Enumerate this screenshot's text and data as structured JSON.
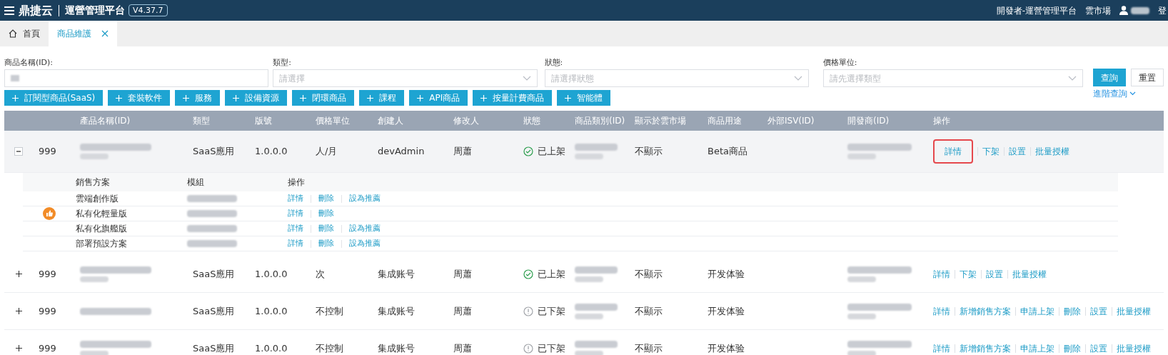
{
  "top_bar": {
    "logo": "鼎捷云",
    "title": "運營管理平台",
    "version": "V4.37.7",
    "links": [
      "開發者-運營管理平台",
      "雲市場"
    ],
    "logout": "登"
  },
  "tabs": [
    {
      "label": "首頁",
      "selected": false,
      "closable": false
    },
    {
      "label": "商品維護",
      "selected": true,
      "closable": true
    }
  ],
  "filters": [
    {
      "label": "商品名稱(ID):",
      "has_value": true,
      "kind": "text"
    },
    {
      "label": "類型:",
      "placeholder": "請選擇",
      "has_value": false,
      "kind": "select"
    },
    {
      "label": "狀態:",
      "placeholder": "請選擇狀態",
      "has_value": false,
      "kind": "select"
    },
    {
      "label": "價格單位:",
      "placeholder": "請先選擇類型",
      "has_value": false,
      "kind": "select"
    }
  ],
  "search_button": "查詢",
  "reset_button": "重置",
  "advanced_link": "進階查詢",
  "add_buttons": [
    "訂閱型商品(SaaS)",
    "套裝軟件",
    "服務",
    "設備資源",
    "閉環商品",
    "課程",
    "API商品",
    "按量計費商品",
    "智能體"
  ],
  "table": {
    "columns": [
      "產品名稱(ID)",
      "類型",
      "版號",
      "價格單位",
      "創建人",
      "修改人",
      "狀態",
      "商品類別(ID)",
      "顯示於雲市場",
      "商品用途",
      "外部ISV(ID)",
      "開發商(ID)",
      "操作"
    ],
    "rows": [
      {
        "expanded": true,
        "id": "999",
        "type": "SaaS應用",
        "version": "1.0.0.0",
        "price_unit": "人/月",
        "creator": "devAdmin",
        "modifier": "周蕭",
        "status": {
          "kind": "on",
          "label": "已上架"
        },
        "display": "不顯示",
        "usage": "Beta商品",
        "operations": [
          {
            "label": "詳情",
            "highlighted": true
          },
          {
            "label": "下架",
            "highlighted": false
          },
          {
            "label": "設置",
            "highlighted": false
          },
          {
            "label": "批量授權",
            "highlighted": false
          }
        ],
        "plans": {
          "columns": [
            "銷售方案",
            "模組",
            "操作"
          ],
          "rows": [
            {
              "name": "雲端創作版",
              "recommended": false,
              "operations": [
                "詳情",
                "刪除",
                "設為推薦"
              ]
            },
            {
              "name": "私有化輕量版",
              "recommended": true,
              "operations": [
                "詳情",
                "刪除"
              ]
            },
            {
              "name": "私有化旗艦版",
              "recommended": false,
              "operations": [
                "詳情",
                "刪除",
                "設為推薦"
              ]
            },
            {
              "name": "部署預設方案",
              "recommended": false,
              "operations": [
                "詳情",
                "刪除",
                "設為推薦"
              ]
            }
          ]
        }
      },
      {
        "expanded": false,
        "id": "999",
        "type": "SaaS應用",
        "version": "1.0.0.0",
        "price_unit": "次",
        "creator": "集成账号",
        "modifier": "周蕭",
        "status": {
          "kind": "on",
          "label": "已上架"
        },
        "display": "不顯示",
        "usage": "开发体验",
        "operations": [
          {
            "label": "詳情",
            "highlighted": false
          },
          {
            "label": "下架",
            "highlighted": false
          },
          {
            "label": "設置",
            "highlighted": false
          },
          {
            "label": "批量授權",
            "highlighted": false
          }
        ]
      },
      {
        "expanded": false,
        "id": "999",
        "type": "SaaS應用",
        "version": "1.0.0.0",
        "price_unit": "不控制",
        "creator": "集成账号",
        "modifier": "周蕭",
        "status": {
          "kind": "off",
          "label": "已下架"
        },
        "display": "不顯示",
        "usage": "开发体验",
        "operations": [
          {
            "label": "詳情",
            "highlighted": false
          },
          {
            "label": "新增銷售方案",
            "highlighted": false
          },
          {
            "label": "申請上架",
            "highlighted": false
          },
          {
            "label": "刪除",
            "highlighted": false
          },
          {
            "label": "設置",
            "highlighted": false
          },
          {
            "label": "批量授權",
            "highlighted": false
          }
        ]
      },
      {
        "expanded": false,
        "id": "999",
        "type": "SaaS應用",
        "version": "1.0.0.0",
        "price_unit": "不控制",
        "creator": "集成账号",
        "modifier": "周蕭",
        "status": {
          "kind": "off",
          "label": "已下架"
        },
        "display": "不顯示",
        "usage": "开发体验",
        "operations": [
          {
            "label": "詳情",
            "highlighted": false
          },
          {
            "label": "新增銷售方案",
            "highlighted": false
          },
          {
            "label": "申請上架",
            "highlighted": false
          },
          {
            "label": "刪除",
            "highlighted": false
          },
          {
            "label": "設置",
            "highlighted": false
          },
          {
            "label": "批量授權",
            "highlighted": false
          }
        ]
      }
    ]
  }
}
